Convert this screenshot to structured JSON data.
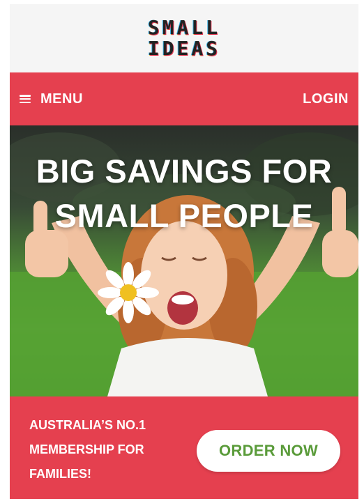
{
  "logo": {
    "line1": "SMALL",
    "line2": "IDEAS"
  },
  "nav": {
    "menu_label": "MENU",
    "login_label": "LOGIN"
  },
  "hero": {
    "title_line1": "BIG SAVINGS FOR",
    "title_line2": "SMALL PEOPLE"
  },
  "promo": {
    "tagline_line1": "AUSTRALIA’S NO.1",
    "tagline_line2": "MEMBERSHIP FOR",
    "tagline_line3": "FAMILIES!",
    "order_label": "ORDER NOW"
  },
  "colors": {
    "brand_red": "#e5404f",
    "button_text_green": "#5a9b3a",
    "logo_bg": "#f5f5f5"
  },
  "icons": {
    "menu": "hamburger-icon"
  }
}
